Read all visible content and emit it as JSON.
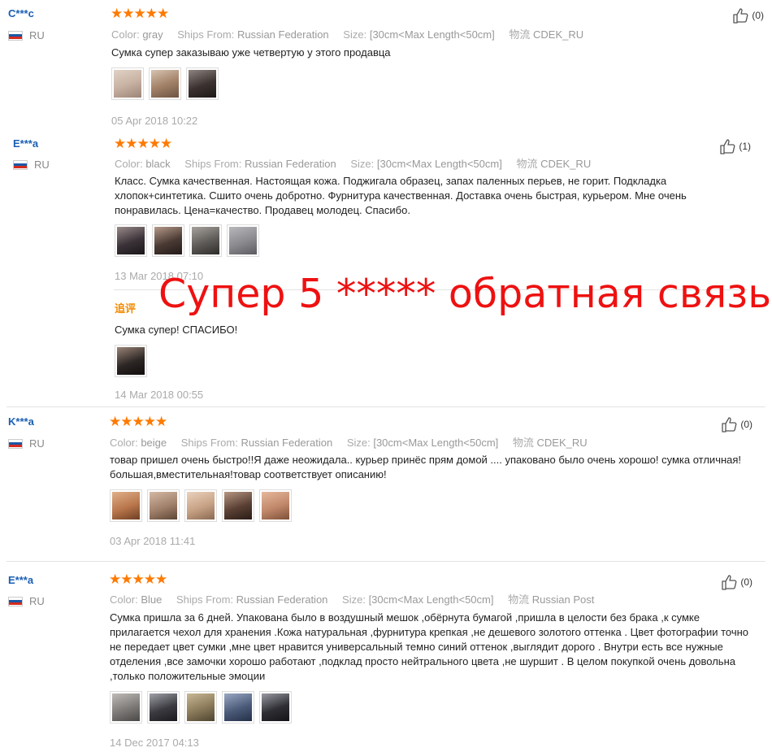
{
  "overlay_text": "Супер 5 ***** обратная связь",
  "reviews": [
    {
      "user": "C***c",
      "country": "RU",
      "stars": "★★★★★",
      "color_label": "Color:",
      "color": "gray",
      "ships_label": "Ships From:",
      "ships": "Russian Federation",
      "size_label": "Size:",
      "size": "[30cm<Max Length<50cm]",
      "logistics_label": "物流",
      "logistics": "CDEK_RU",
      "text": "Сумка супер заказываю уже четвертую у этого продавца",
      "date": "05 Apr 2018 10:22",
      "likes": "(0)",
      "photos": [
        "#c9b3a4",
        "#a5846a",
        "#3b3130"
      ]
    },
    {
      "user": "E***a",
      "country": "RU",
      "stars": "★★★★★",
      "color_label": "Color:",
      "color": "black",
      "ships_label": "Ships From:",
      "ships": "Russian Federation",
      "size_label": "Size:",
      "size": "[30cm<Max Length<50cm]",
      "logistics_label": "物流",
      "logistics": "CDEK_RU",
      "text": "Класс. Сумка качественная. Настоящая кожа. Поджигала образец, запах паленных перьев, не горит. Подкладка хлопок+синтетика. Сшито очень добротно. Фурнитура качественная. Доставка очень быстрая, курьером. Мне очень понравилась. Цена=качество. Продавец молодец. Спасибо.",
      "date": "13 Mar 2018 07:10",
      "likes": "(1)",
      "photos": [
        "#3a3238",
        "#4a3a34",
        "#5d5a57",
        "#8a8a8e"
      ],
      "followup": {
        "label": "追评",
        "text": "Сумка супер! СПАСИБО!",
        "date": "14 Mar 2018 00:55",
        "photos": [
          "#2c2624"
        ]
      }
    },
    {
      "user": "K***a",
      "country": "RU",
      "stars": "★★★★★",
      "color_label": "Color:",
      "color": "beige",
      "ships_label": "Ships From:",
      "ships": "Russian Federation",
      "size_label": "Size:",
      "size": "[30cm<Max Length<50cm]",
      "logistics_label": "物流",
      "logistics": "CDEK_RU",
      "text": "товар пришел очень быстро!!Я даже неожидала.. курьер принёс прям домой .... упаковано было очень хорошо! сумка отличная! большая,вместительная!товар соответствует описанию!",
      "date": "03 Apr 2018 11:41",
      "likes": "(0)",
      "photos": [
        "#b9764b",
        "#a0806a",
        "#c7a184",
        "#5a4034",
        "#c0876a"
      ]
    },
    {
      "user": "E***a",
      "country": "RU",
      "stars": "★★★★★",
      "color_label": "Color:",
      "color": "Blue",
      "ships_label": "Ships From:",
      "ships": "Russian Federation",
      "size_label": "Size:",
      "size": "[30cm<Max Length<50cm]",
      "logistics_label": "物流",
      "logistics": "Russian Post",
      "text": "Сумка пришла за 6 дней. Упакована было в воздушный мешок ,обёрнута бумагой ,пришла в целости без брака ,к сумке прилагается чехол для хранения .Кожа натуральная ,фурнитура крепкая ,не дешевого золотого оттенка . Цвет фотографии точно не передает цвет сумки ,мне цвет нравится универсальный темно синий оттенок ,выглядит дорого . Внутри есть все нужные отделения ,все замочки хорошо работают ,подклад просто нейтрального цвета ,не шуршит . В целом покупкой очень довольна ,только положительные эмоции",
      "date": "14 Dec 2017 04:13",
      "likes": "(0)",
      "photos": [
        "#7d7a78",
        "#3a3a40",
        "#8a7a5a",
        "#4a5a78",
        "#2e2e34"
      ]
    }
  ]
}
